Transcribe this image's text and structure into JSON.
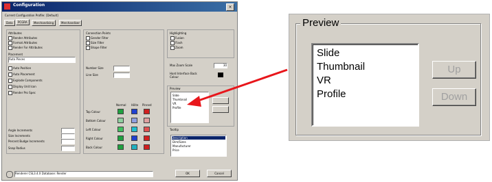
{
  "dialog": {
    "title": "Configuration",
    "menu": [
      "Current Configuration Profile:",
      "[Default]"
    ],
    "tabs": [
      "Data",
      "PCGRA",
      "Merchandising",
      "Merchandiser"
    ],
    "attributes_group": "Attributes",
    "attributes": [
      "Render Attributes",
      "Format Attributes",
      "Render For Attributes"
    ],
    "placement_group": "Placement",
    "placement_select": "Auto Pieces",
    "placement_opts": [
      "Auto Position",
      "Auto Placement",
      "Explode Components",
      "Display Unit Icon",
      "Render Pro Spec"
    ],
    "connection_group": "Connection Points",
    "connection_opts": [
      "Gender Filter",
      "Size Filter",
      "Shape Filter"
    ],
    "number_label": "Number Size",
    "line_label": "Line Size",
    "swatch_headers": [
      "Normal",
      "Hilite",
      "Pinned"
    ],
    "colour_rows": [
      "Top Colour",
      "Bottom Colour",
      "Left Colour",
      "Right Colour",
      "Back Colour"
    ],
    "bottom_fields": [
      "Angle Increments",
      "Size Increments",
      "Percent Budge Increments",
      "Snap Radius"
    ],
    "highlighting_group": "Highlighting",
    "highlighting_opts": [
      "Fusion",
      "Flash",
      "Zoom"
    ],
    "max_zoom_label": "Max Zoom Scale",
    "max_zoom_value": "30",
    "hard_label": "Hard Interface Back Colour",
    "preview_group": "Preview",
    "preview_items": [
      "Slide",
      "Thumbnail",
      "VR",
      "Profile"
    ],
    "tooltip_group": "Tooltip",
    "tooltip_items": [
      "Description",
      "Dim/Sizes",
      "Manufacturer",
      "Price"
    ],
    "status": "Renderer CSL3.4.X Database: Render",
    "ok": "OK",
    "cancel": "Cancel"
  },
  "zoom": {
    "legend": "Preview",
    "items": [
      "Slide",
      "Thumbnail",
      "VR",
      "Profile"
    ],
    "up": "Up",
    "down": "Down"
  },
  "colors": {
    "arrow": "#e8161b",
    "titlebar": "#0a246a",
    "dialog_bg": "#d4d0c8"
  }
}
